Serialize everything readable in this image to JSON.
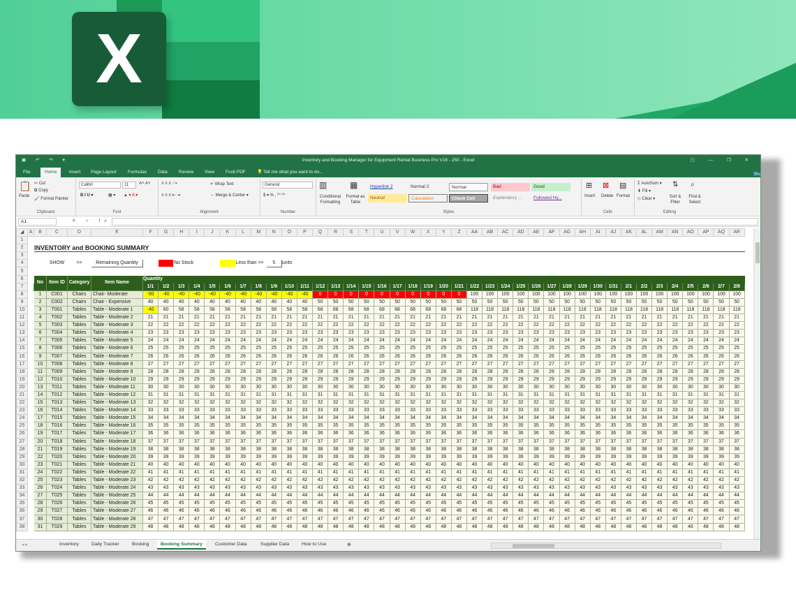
{
  "window": {
    "title": "Inventory and Booking Manager for Equipment Rental Business Pro V16 - 250 - Excel",
    "share": "Share"
  },
  "banner": {
    "logo_letter": "X"
  },
  "ribbon_tabs": [
    "File",
    "Home",
    "Insert",
    "Page Layout",
    "Formulas",
    "Data",
    "Review",
    "View",
    "Foxit PDF",
    "Tell me what you want to do..."
  ],
  "ribbon": {
    "clipboard": {
      "paste": "Paste",
      "cut": "Cut",
      "copy": "Copy",
      "format_painter": "Format Painter",
      "label": "Clipboard"
    },
    "font": {
      "family": "Calibri",
      "size": "11",
      "label": "Font"
    },
    "alignment": {
      "wrap": "Wrap Text",
      "merge": "Merge & Center",
      "label": "Alignment"
    },
    "number": {
      "format": "General",
      "label": "Number"
    },
    "styles": {
      "conditional": "Conditional Formatting",
      "format_table": "Format as Table",
      "items": [
        "Hyperlink 2",
        "Normal 2",
        "Normal",
        "Bad",
        "Good",
        "Neutral",
        "Calculation",
        "Check Cell",
        "Explanatory ...",
        "Followed Hy..."
      ],
      "label": "Styles"
    },
    "cells": {
      "insert": "Insert",
      "delete": "Delete",
      "format": "Format",
      "label": "Cells"
    },
    "editing": {
      "autosum": "AutoSum",
      "fill": "Fill",
      "clear": "Clear",
      "sort": "Sort & Filter",
      "find": "Find & Select",
      "label": "Editing"
    }
  },
  "formula_bar": {
    "name_box": "A1",
    "fx": "fx",
    "value": ""
  },
  "columns": [
    "A",
    "B",
    "C",
    "D",
    "E",
    "F",
    "G",
    "H",
    "I",
    "J",
    "K",
    "L",
    "M",
    "N",
    "O",
    "P",
    "Q",
    "R",
    "S",
    "T",
    "U",
    "V",
    "W",
    "X",
    "Y",
    "Z",
    "AA",
    "AB",
    "AC",
    "AD",
    "AE",
    "AF",
    "AG",
    "AH",
    "AI",
    "AJ",
    "AK",
    "AL",
    "AM",
    "AN",
    "AO",
    "AP",
    "AQ",
    "AR"
  ],
  "sheet": {
    "title": "INVENTORY and BOOKING SUMMARY",
    "show_label": "SHOW",
    "arrow": ">>",
    "show_value": "Remaining Quantity",
    "legend_no_stock": "No Stock",
    "legend_less_than": "Less than >>",
    "threshold": "5",
    "units": "units",
    "quantity_header": "Quantity",
    "headers": {
      "no": "No",
      "item_id": "Item ID",
      "category": "Category",
      "item_name": "Item Name"
    },
    "dates": [
      "1/1",
      "1/2",
      "1/3",
      "1/4",
      "1/5",
      "1/6",
      "1/7",
      "1/8",
      "1/9",
      "1/10",
      "1/11",
      "1/12",
      "1/13",
      "1/14",
      "1/15",
      "1/16",
      "1/17",
      "1/18",
      "1/19",
      "1/20",
      "1/21",
      "1/22",
      "1/23",
      "1/24",
      "1/25",
      "1/26",
      "1/27",
      "1/28",
      "1/29",
      "1/30",
      "1/31",
      "2/1",
      "2/2",
      "2/3",
      "2/4",
      "2/5",
      "2/6",
      "2/7",
      "2/8"
    ],
    "rows": [
      {
        "r": "8",
        "no": "1",
        "id": "C001",
        "cat": "Chairs",
        "name": "Chair- Moderate",
        "vals": [
          "-90",
          "-40",
          "-40",
          "-40",
          "-40",
          "-40",
          "-40",
          "-40",
          "-40",
          "-40",
          "-40",
          "0",
          "0",
          "0",
          "0",
          "0",
          "0",
          "0",
          "0",
          "0",
          "0",
          "100",
          "100",
          "100",
          "100",
          "100",
          "100",
          "100",
          "100",
          "100",
          "100",
          "100",
          "100",
          "100",
          "100",
          "100",
          "100",
          "100",
          "100"
        ]
      },
      {
        "r": "9",
        "no": "2",
        "id": "C002",
        "cat": "Chairs",
        "name": "Chair - Expensive",
        "vals": [
          "40",
          "40",
          "40",
          "40",
          "40",
          "40",
          "40",
          "40",
          "40",
          "40",
          "40",
          "50",
          "50",
          "50",
          "50",
          "50",
          "50",
          "50",
          "50",
          "50",
          "50",
          "50",
          "50",
          "50",
          "50",
          "50",
          "50",
          "50",
          "50",
          "50",
          "50",
          "50",
          "50",
          "50",
          "50",
          "50",
          "50",
          "50",
          "50"
        ]
      },
      {
        "r": "10",
        "no": "3",
        "id": "T001",
        "cat": "Tables",
        "name": "Table - Moderate 1",
        "vals": [
          "-40",
          "60",
          "58",
          "58",
          "58",
          "58",
          "58",
          "58",
          "58",
          "58",
          "58",
          "68",
          "68",
          "68",
          "68",
          "68",
          "68",
          "68",
          "68",
          "68",
          "68",
          "118",
          "118",
          "118",
          "118",
          "118",
          "118",
          "118",
          "118",
          "118",
          "118",
          "118",
          "118",
          "118",
          "118",
          "118",
          "118",
          "118",
          "118"
        ]
      },
      {
        "r": "11",
        "no": "4",
        "id": "T002",
        "cat": "Tables",
        "name": "Table - Moderate 2",
        "v": "21"
      },
      {
        "r": "12",
        "no": "5",
        "id": "T003",
        "cat": "Tables",
        "name": "Table - Moderate 3",
        "v": "22"
      },
      {
        "r": "13",
        "no": "6",
        "id": "T004",
        "cat": "Tables",
        "name": "Table - Moderate 4",
        "v": "23"
      },
      {
        "r": "14",
        "no": "7",
        "id": "T005",
        "cat": "Tables",
        "name": "Table - Moderate 5",
        "v": "24"
      },
      {
        "r": "15",
        "no": "8",
        "id": "T006",
        "cat": "Tables",
        "name": "Table - Moderate 6",
        "v": "25"
      },
      {
        "r": "16",
        "no": "9",
        "id": "T007",
        "cat": "Tables",
        "name": "Table - Moderate 7",
        "v": "26"
      },
      {
        "r": "17",
        "no": "10",
        "id": "T008",
        "cat": "Tables",
        "name": "Table - Moderate 8",
        "v": "27"
      },
      {
        "r": "18",
        "no": "11",
        "id": "T009",
        "cat": "Tables",
        "name": "Table - Moderate 9",
        "v": "28"
      },
      {
        "r": "19",
        "no": "12",
        "id": "T010",
        "cat": "Tables",
        "name": "Table - Moderate 10",
        "v": "29"
      },
      {
        "r": "20",
        "no": "13",
        "id": "T011",
        "cat": "Tables",
        "name": "Table - Moderate 11",
        "v": "30"
      },
      {
        "r": "21",
        "no": "14",
        "id": "T012",
        "cat": "Tables",
        "name": "Table - Moderate 12",
        "v": "31"
      },
      {
        "r": "22",
        "no": "15",
        "id": "T013",
        "cat": "Tables",
        "name": "Table - Moderate 13",
        "v": "32"
      },
      {
        "r": "23",
        "no": "16",
        "id": "T014",
        "cat": "Tables",
        "name": "Table - Moderate 14",
        "v": "33"
      },
      {
        "r": "24",
        "no": "17",
        "id": "T015",
        "cat": "Tables",
        "name": "Table - Moderate 15",
        "v": "34"
      },
      {
        "r": "25",
        "no": "18",
        "id": "T016",
        "cat": "Tables",
        "name": "Table - Moderate 16",
        "v": "35"
      },
      {
        "r": "26",
        "no": "19",
        "id": "T017",
        "cat": "Tables",
        "name": "Table - Moderate 17",
        "v": "36"
      },
      {
        "r": "27",
        "no": "20",
        "id": "T018",
        "cat": "Tables",
        "name": "Table - Moderate 18",
        "v": "37"
      },
      {
        "r": "28",
        "no": "21",
        "id": "T019",
        "cat": "Tables",
        "name": "Table - Moderate 19",
        "v": "38"
      },
      {
        "r": "29",
        "no": "22",
        "id": "T020",
        "cat": "Tables",
        "name": "Table - Moderate 20",
        "v": "39"
      },
      {
        "r": "30",
        "no": "23",
        "id": "T021",
        "cat": "Tables",
        "name": "Table - Moderate 21",
        "v": "40"
      },
      {
        "r": "31",
        "no": "24",
        "id": "T022",
        "cat": "Tables",
        "name": "Table - Moderate 22",
        "v": "41"
      },
      {
        "r": "32",
        "no": "25",
        "id": "T023",
        "cat": "Tables",
        "name": "Table - Moderate 23",
        "v": "42"
      },
      {
        "r": "33",
        "no": "26",
        "id": "T024",
        "cat": "Tables",
        "name": "Table - Moderate 24",
        "v": "43"
      },
      {
        "r": "34",
        "no": "27",
        "id": "T025",
        "cat": "Tables",
        "name": "Table - Moderate 25",
        "v": "44"
      },
      {
        "r": "35",
        "no": "28",
        "id": "T026",
        "cat": "Tables",
        "name": "Table - Moderate 26",
        "v": "45"
      },
      {
        "r": "36",
        "no": "29",
        "id": "T027",
        "cat": "Tables",
        "name": "Table - Moderate 27",
        "v": "46"
      },
      {
        "r": "37",
        "no": "30",
        "id": "T028",
        "cat": "Tables",
        "name": "Table - Moderate 28",
        "v": "47"
      },
      {
        "r": "38",
        "no": "31",
        "id": "T029",
        "cat": "Tables",
        "name": "Table - Moderate 29",
        "v": "48"
      }
    ]
  },
  "sheet_tabs": [
    "Inventory",
    "Daily Tracker",
    "Booking",
    "Booking Summary",
    "Customer Data",
    "Supplier Data",
    "How to Use"
  ],
  "active_sheet": "Booking Summary",
  "colors": {
    "excel_green": "#217346",
    "header_green": "#2e5e1c",
    "no_stock": "#ff0000",
    "low_stock": "#ffff00"
  }
}
